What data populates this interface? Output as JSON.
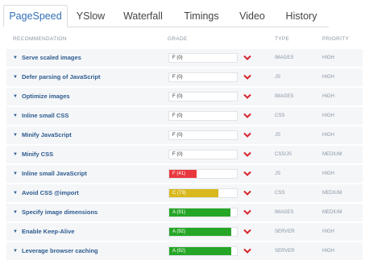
{
  "tabs": [
    {
      "label": "PageSpeed",
      "active": true
    },
    {
      "label": "YSlow",
      "active": false
    },
    {
      "label": "Waterfall",
      "active": false
    },
    {
      "label": "Timings",
      "active": false
    },
    {
      "label": "Video",
      "active": false
    },
    {
      "label": "History",
      "active": false
    }
  ],
  "columns": {
    "recommendation": "RECOMMENDATION",
    "grade": "GRADE",
    "type": "TYPE",
    "priority": "PRIORITY"
  },
  "colors": {
    "red": "#e8383d",
    "yellow": "#d8b81c",
    "green": "#26a626",
    "chevron": "#d8232a",
    "link": "#2f5b8f"
  },
  "rows": [
    {
      "name": "Serve scaled images",
      "grade": "F (0)",
      "score": 0,
      "color": "none",
      "type": "IMAGES",
      "priority": "HIGH"
    },
    {
      "name": "Defer parsing of JavaScript",
      "grade": "F (0)",
      "score": 0,
      "color": "none",
      "type": "JS",
      "priority": "HIGH"
    },
    {
      "name": "Optimize images",
      "grade": "F (0)",
      "score": 0,
      "color": "none",
      "type": "IMAGES",
      "priority": "HIGH"
    },
    {
      "name": "Inline small CSS",
      "grade": "F (0)",
      "score": 0,
      "color": "none",
      "type": "CSS",
      "priority": "HIGH"
    },
    {
      "name": "Minify JavaScript",
      "grade": "F (0)",
      "score": 0,
      "color": "none",
      "type": "JS",
      "priority": "HIGH"
    },
    {
      "name": "Minify CSS",
      "grade": "F (0)",
      "score": 0,
      "color": "none",
      "type": "CSS/JS",
      "priority": "MEDIUM"
    },
    {
      "name": "Inline small JavaScript",
      "grade": "F (41)",
      "score": 41,
      "color": "red",
      "type": "JS",
      "priority": "HIGH"
    },
    {
      "name": "Avoid CSS @import",
      "grade": "C (73)",
      "score": 73,
      "color": "yellow",
      "type": "CSS",
      "priority": "MEDIUM"
    },
    {
      "name": "Specify image dimensions",
      "grade": "A (91)",
      "score": 91,
      "color": "green",
      "type": "IMAGES",
      "priority": "MEDIUM"
    },
    {
      "name": "Enable Keep-Alive",
      "grade": "A (92)",
      "score": 92,
      "color": "green",
      "type": "SERVER",
      "priority": "HIGH"
    },
    {
      "name": "Leverage browser caching",
      "grade": "A (92)",
      "score": 92,
      "color": "green",
      "type": "SERVER",
      "priority": "HIGH"
    }
  ]
}
